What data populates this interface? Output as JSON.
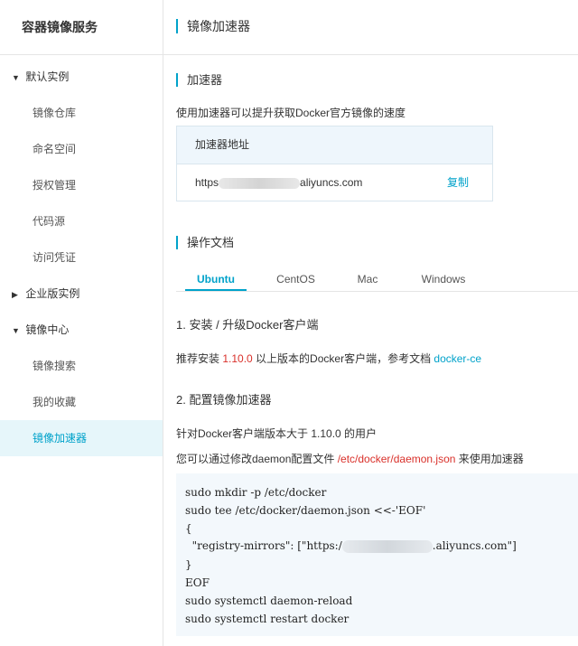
{
  "sidebar": {
    "title": "容器镜像服务",
    "groups": [
      {
        "label": "默认实例",
        "arrow": "▼",
        "items": [
          "镜像仓库",
          "命名空间",
          "授权管理",
          "代码源",
          "访问凭证"
        ]
      },
      {
        "label": "企业版实例",
        "arrow": "▶",
        "items": []
      },
      {
        "label": "镜像中心",
        "arrow": "▼",
        "items": [
          "镜像搜索",
          "我的收藏",
          "镜像加速器"
        ]
      }
    ],
    "active_item": "镜像加速器"
  },
  "header": {
    "title": "镜像加速器"
  },
  "accelerator": {
    "section_title": "加速器",
    "description": "使用加速器可以提升获取Docker官方镜像的速度",
    "box_header": "加速器地址",
    "url_prefix": "https",
    "url_suffix": "aliyuncs.com",
    "copy_label": "复制"
  },
  "docs": {
    "section_title": "操作文档",
    "tabs": [
      "Ubuntu",
      "CentOS",
      "Mac",
      "Windows"
    ],
    "active_tab": "Ubuntu",
    "step1_title": "1. 安装 / 升级Docker客户端",
    "step1_text_a": "推荐安装 ",
    "step1_version": "1.10.0",
    "step1_text_b": " 以上版本的Docker客户端，参考文档 ",
    "step1_link": "docker-ce",
    "step2_title": "2. 配置镜像加速器",
    "step2_line1": "针对Docker客户端版本大于 1.10.0 的用户",
    "step2_line2_a": "您可以通过修改daemon配置文件 ",
    "step2_path": "/etc/docker/daemon.json",
    "step2_line2_b": " 来使用加速器"
  },
  "code": {
    "line1": "sudo mkdir -p /etc/docker",
    "line2": "sudo tee /etc/docker/daemon.json <<-'EOF'",
    "line3": "{",
    "line4_a": "  \"registry-mirrors\": [\"https:/",
    "line4_b": ".aliyuncs.com\"]",
    "line5": "}",
    "line6": "EOF",
    "line7": "sudo systemctl daemon-reload",
    "line8": "sudo systemctl restart docker"
  },
  "colors": {
    "accent": "#00a2ca",
    "active_bg": "#e6f6fa",
    "highlight_red": "#d9302a",
    "code_bg": "#f3f8fc"
  }
}
